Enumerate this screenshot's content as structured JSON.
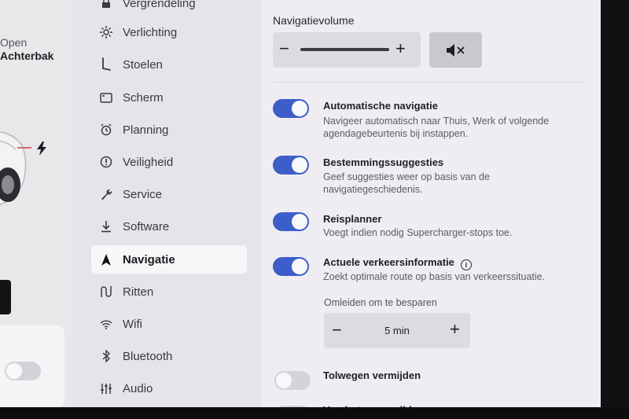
{
  "car": {
    "open_label": "Open",
    "trunk_label": "Achterbak"
  },
  "menu": {
    "items": [
      {
        "label": "Vergrendeling",
        "icon": "lock-icon",
        "active": false
      },
      {
        "label": "Verlichting",
        "icon": "light-icon",
        "active": false
      },
      {
        "label": "Stoelen",
        "icon": "seat-icon",
        "active": false
      },
      {
        "label": "Scherm",
        "icon": "display-icon",
        "active": false
      },
      {
        "label": "Planning",
        "icon": "alarm-clock-icon",
        "active": false
      },
      {
        "label": "Veiligheid",
        "icon": "safety-icon",
        "active": false
      },
      {
        "label": "Service",
        "icon": "wrench-icon",
        "active": false
      },
      {
        "label": "Software",
        "icon": "download-icon",
        "active": false
      },
      {
        "label": "Navigatie",
        "icon": "navigation-arrow-icon",
        "active": true
      },
      {
        "label": "Ritten",
        "icon": "trips-icon",
        "active": false
      },
      {
        "label": "Wifi",
        "icon": "wifi-icon",
        "active": false
      },
      {
        "label": "Bluetooth",
        "icon": "bluetooth-icon",
        "active": false
      },
      {
        "label": "Audio",
        "icon": "audio-sliders-icon",
        "active": false
      }
    ]
  },
  "navigation": {
    "volume_title": "Navigatievolume",
    "volume_minus": "−",
    "volume_plus": "+",
    "volume_level": 0.85,
    "mute_icon": "speaker-mute-icon",
    "options": [
      {
        "title": "Automatische navigatie",
        "desc": "Navigeer automatisch naar Thuis, Werk of volgende agendagebeurtenis bij instappen.",
        "on": true
      },
      {
        "title": "Bestemmingssuggesties",
        "desc": "Geef suggesties weer op basis van de navigatiegeschiedenis.",
        "on": true
      },
      {
        "title": "Reisplanner",
        "desc": "Voegt indien nodig Supercharger-stops toe.",
        "on": true
      },
      {
        "title": "Actuele verkeersinformatie",
        "desc": "Zoekt optimale route op basis van verkeerssituatie.",
        "on": true,
        "info": "i"
      }
    ],
    "detour": {
      "label": "Omleiden om te besparen",
      "value": "5 min",
      "minus": "−",
      "plus": "+"
    },
    "toll": {
      "title": "Tolwegen vermijden",
      "on": false
    },
    "ferry": {
      "title": "Veerboten vermijden",
      "on": false
    }
  },
  "colors": {
    "accent": "#3d5dc8",
    "toggle_off": "#d4d3d8"
  }
}
